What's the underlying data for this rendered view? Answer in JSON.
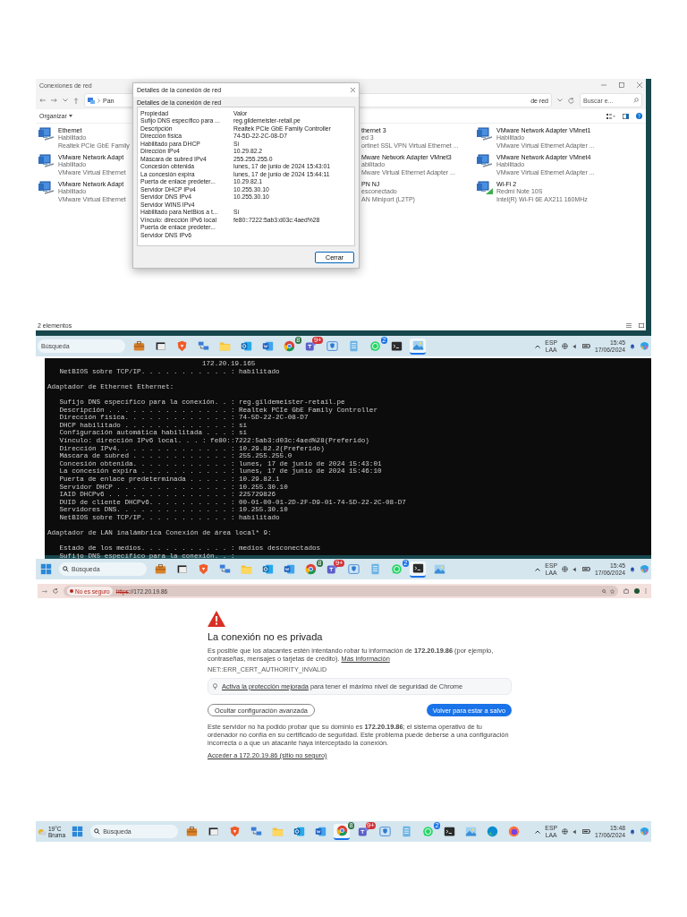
{
  "explorer_screenshot": {
    "window": {
      "title": "Conexiones de red",
      "address_start": "Pan",
      "address_end": "de red",
      "search_placeholder": "Buscar e...",
      "menu": "Organizar",
      "status": "2 elementos"
    },
    "columns": [
      {
        "items": [
          {
            "kind": "wired",
            "name": "Ethernet",
            "status": "Habilitado",
            "device": "Realtek PCIe GbE Family"
          },
          {
            "kind": "wired",
            "name": "VMware Network Adapt",
            "status": "Habilitado",
            "device": "VMware Virtual Ethernet"
          },
          {
            "kind": "wired",
            "name": "VMware Network Adapt",
            "status": "Habilitado",
            "device": "VMware Virtual Ethernet"
          }
        ]
      },
      {
        "items": [
          {
            "name": "thernet 3",
            "status": "ed 3",
            "device": "ortinet SSL VPN Virtual Ethernet ..."
          },
          {
            "name": "Mware Network Adapter VMnet3",
            "status": "abilitado",
            "device": "Mware Virtual Ethernet Adapter ..."
          },
          {
            "name": "PN NJ",
            "status": "esconectado",
            "device": "AN Miniport (L2TP)"
          }
        ]
      },
      {
        "items": [
          {
            "kind": "wired",
            "name": "VMware Network Adapter VMnet1",
            "status": "Habilitado",
            "device": "VMware Virtual Ethernet Adapter ..."
          },
          {
            "kind": "wired",
            "name": "VMware Network Adapter VMnet4",
            "status": "Habilitado",
            "device": "VMware Virtual Ethernet Adapter ..."
          },
          {
            "kind": "wifi",
            "name": "Wi-Fi 2",
            "status": "Redmi Note 10S",
            "device": "Intel(R) Wi-Fi 6E AX211 160MHz"
          }
        ]
      }
    ],
    "dialog": {
      "title": "Detalles de la conexión de red",
      "group": "Detalles de la conexión de red",
      "columns": [
        "Propiedad",
        "Valor"
      ],
      "rows": [
        [
          "Sufijo DNS específico para ...",
          "reg.gildemeister-retail.pe"
        ],
        [
          "Descripción",
          "Realtek PCIe GbE Family Controller"
        ],
        [
          "Dirección física",
          "74-5D-22-2C-08-D7"
        ],
        [
          "Habilitado para DHCP",
          "Sí"
        ],
        [
          "Dirección IPv4",
          "10.29.82.2"
        ],
        [
          "Máscara de subred IPv4",
          "255.255.255.0"
        ],
        [
          "Concesión obtenida",
          "lunes, 17 de junio de 2024 15:43:01"
        ],
        [
          "La concesión expira",
          "lunes, 17 de junio de 2024 15:44:11"
        ],
        [
          "Puerta de enlace predeter...",
          "10.29.82.1"
        ],
        [
          "Servidor DHCP IPv4",
          "10.255.30.10"
        ],
        [
          "Servidor DNS IPv4",
          "10.255.30.10"
        ],
        [
          "Servidor WINS IPv4",
          ""
        ],
        [
          "Habilitado para NetBios a t...",
          "Sí"
        ],
        [
          "Vínculo: dirección IPv6 local",
          "fe80::7222:5ab3:d03c:4aed%28"
        ],
        [
          "Puerta de enlace predeter...",
          ""
        ],
        [
          "Servidor DNS IPv6",
          ""
        ]
      ],
      "button": "Cerrar"
    },
    "taskbar": {
      "search": {
        "placeholder": "Búsqueda",
        "has_icon": false
      },
      "apps": [
        {
          "kind": "briefcase",
          "selected": false
        },
        {
          "kind": "taskview",
          "selected": false
        },
        {
          "kind": "brave",
          "selected": false
        },
        {
          "kind": "network",
          "selected": false
        },
        {
          "kind": "folder",
          "selected": false
        },
        {
          "kind": "outlook",
          "selected": false
        },
        {
          "kind": "word",
          "selected": false
        },
        {
          "kind": "chrome",
          "badge": "8",
          "selected": false
        },
        {
          "kind": "teams",
          "badge": "9+",
          "selected": false
        },
        {
          "kind": "defender",
          "selected": false
        },
        {
          "kind": "notepad",
          "selected": false
        },
        {
          "kind": "whatsapp",
          "badge": "2",
          "selected": false
        },
        {
          "kind": "terminal",
          "selected": false
        },
        {
          "kind": "photos",
          "selected": true
        }
      ],
      "tray": {
        "language": [
          "ESP",
          "LAA"
        ],
        "time": "15:45",
        "date": "17/06/2024"
      }
    }
  },
  "terminal_screenshot": {
    "lines": [
      {
        "kind": "continuation",
        "text": "172.20.19.165"
      },
      {
        "kind": "entry",
        "text": "NetBIOS sobre TCP/IP. . . . . . . . . . . : habilitado"
      },
      {
        "kind": "heading",
        "text": "Adaptador de Ethernet Ethernet:"
      },
      {
        "kind": "entry",
        "text": "Sufijo DNS específico para la conexión. . : reg.gildemeister-retail.pe"
      },
      {
        "kind": "entry",
        "text": "Descripción . . . . . . . . . . . . . . . : Realtek PCIe GbE Family Controller"
      },
      {
        "kind": "entry",
        "text": "Dirección física. . . . . . . . . . . . . : 74-5D-22-2C-08-D7"
      },
      {
        "kind": "entry",
        "text": "DHCP habilitado . . . . . . . . . . . . . : sí"
      },
      {
        "kind": "entry",
        "text": "Configuración automática habilitada . . . : sí"
      },
      {
        "kind": "entry",
        "text": "Vínculo: dirección IPv6 local. . . : fe80::7222:5ab3:d03c:4aed%28(Preferido)"
      },
      {
        "kind": "entry",
        "text": "Dirección IPv4. . . . . . . . . . . . . . : 10.29.82.2(Preferido)"
      },
      {
        "kind": "entry",
        "text": "Máscara de subred . . . . . . . . . . . . : 255.255.255.0"
      },
      {
        "kind": "entry",
        "text": "Concesión obtenida. . . . . . . . . . . . : lunes, 17 de junio de 2024 15:43:01"
      },
      {
        "kind": "entry",
        "text": "La concesión expira . . . . . . . . . . . : lunes, 17 de junio de 2024 15:46:10"
      },
      {
        "kind": "entry",
        "text": "Puerta de enlace predeterminada . . . . . : 10.29.82.1"
      },
      {
        "kind": "entry",
        "text": "Servidor DHCP . . . . . . . . . . . . . . : 10.255.30.10"
      },
      {
        "kind": "entry",
        "text": "IAID DHCPv6 . . . . . . . . . . . . . . . : 225729826"
      },
      {
        "kind": "entry",
        "text": "DUID de cliente DHCPv6. . . . . . . . . . : 00-01-00-01-2D-2F-D9-01-74-5D-22-2C-08-D7"
      },
      {
        "kind": "entry",
        "text": "Servidores DNS. . . . . . . . . . . . . . : 10.255.30.10"
      },
      {
        "kind": "entry",
        "text": "NetBIOS sobre TCP/IP. . . . . . . . . . . : habilitado"
      },
      {
        "kind": "heading",
        "text": "Adaptador de LAN inalámbrica Conexión de área local* 9:"
      },
      {
        "kind": "entry",
        "text": "Estado de los medios. . . . . . . . . . . : medios desconectados"
      },
      {
        "kind": "entry",
        "text": "Sufijo DNS específico para la conexión. . :"
      }
    ],
    "taskbar": {
      "search": {
        "placeholder": "Búsqueda",
        "has_icon": true
      },
      "apps": [
        {
          "kind": "start",
          "selected": false
        },
        {
          "kind": "briefcase",
          "selected": false
        },
        {
          "kind": "taskview",
          "selected": false
        },
        {
          "kind": "brave",
          "selected": false
        },
        {
          "kind": "network",
          "selected": false
        },
        {
          "kind": "folder",
          "selected": false
        },
        {
          "kind": "outlook",
          "selected": false
        },
        {
          "kind": "word",
          "selected": false
        },
        {
          "kind": "chrome",
          "badge": "8",
          "selected": false
        },
        {
          "kind": "teams",
          "badge": "9+",
          "selected": false
        },
        {
          "kind": "defender",
          "selected": false
        },
        {
          "kind": "notepad",
          "selected": false
        },
        {
          "kind": "whatsapp",
          "badge": "2",
          "selected": false
        },
        {
          "kind": "terminal",
          "selected": true
        },
        {
          "kind": "photos",
          "selected": false
        }
      ],
      "tray": {
        "language": [
          "ESP",
          "LAA"
        ],
        "time": "15:45",
        "date": "17/06/2024"
      }
    }
  },
  "browser_screenshot": {
    "toolbar": {
      "security_chip": "No es seguro",
      "url_scheme": "https",
      "url_rest": "://172.20.19.86"
    },
    "page": {
      "heading": "La conexión no es privada",
      "intro": "Es posible que los atacantes estén intentando robar tu información de **172.20.19.86** (por ejemplo, contraseñas, mensajes o tarjetas de crédito).",
      "intro_link": "Más información",
      "error_code": "NET::ERR_CERT_AUTHORITY_INVALID",
      "tip_link": "Activa la protección mejorada",
      "tip_text": "para tener el máximo nivel de seguridad de Chrome",
      "secondary_button": "Ocultar configuración avanzada",
      "primary_button": "Volver para estar a salvo",
      "details": "Este servidor no ha podido probar que su dominio es **172.20.19.86**; el sistema operativo de tu ordenador no confía en su certificado de seguridad. Este problema puede deberse a una configuración incorrecta o a que un atacante haya interceptado la conexión.",
      "proceed_link": "Acceder a 172.20.19.86 (sitio no seguro)"
    },
    "taskbar": {
      "weather": {
        "temperature": "19°C",
        "condition": "Bruma"
      },
      "search": {
        "placeholder": "Búsqueda",
        "has_icon": true
      },
      "apps": [
        {
          "kind": "start",
          "selected": false
        },
        {
          "kind": "briefcase",
          "selected": false
        },
        {
          "kind": "taskview",
          "selected": false
        },
        {
          "kind": "brave",
          "selected": false
        },
        {
          "kind": "network",
          "selected": false
        },
        {
          "kind": "folder",
          "selected": false
        },
        {
          "kind": "outlook",
          "selected": false
        },
        {
          "kind": "word",
          "selected": false
        },
        {
          "kind": "chrome",
          "badge": "8",
          "selected": true
        },
        {
          "kind": "teams",
          "badge": "9+",
          "selected": false
        },
        {
          "kind": "defender",
          "selected": false
        },
        {
          "kind": "notepad",
          "selected": false
        },
        {
          "kind": "whatsapp",
          "badge": "2",
          "selected": false
        },
        {
          "kind": "terminal",
          "selected": false
        },
        {
          "kind": "photos",
          "selected": false
        },
        {
          "kind": "edge",
          "selected": false
        },
        {
          "kind": "firefox",
          "selected": false
        }
      ],
      "tray": {
        "language": [
          "ESP",
          "LAA"
        ],
        "time": "15:48",
        "date": "17/06/2024"
      }
    }
  }
}
